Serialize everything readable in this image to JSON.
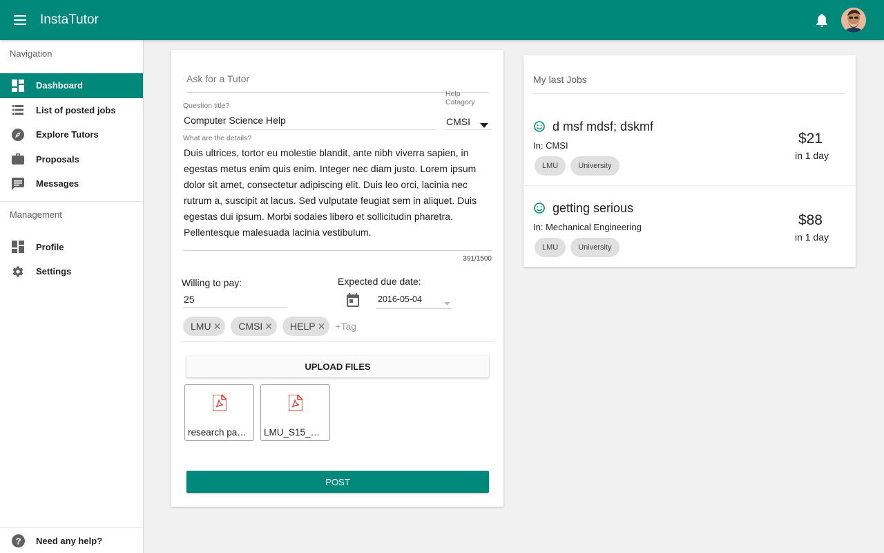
{
  "app": {
    "title": "InstaTutor",
    "accent": "#00897b"
  },
  "sidebar": {
    "navigation_title": "Navigation",
    "nav_items": [
      {
        "label": "Dashboard",
        "icon": "dashboard-icon",
        "active": true
      },
      {
        "label": "List of posted jobs",
        "icon": "list-icon"
      },
      {
        "label": "Explore Tutors",
        "icon": "compass-icon"
      },
      {
        "label": "Proposals",
        "icon": "briefcase-icon"
      },
      {
        "label": "Messages",
        "icon": "message-icon"
      }
    ],
    "management_title": "Management",
    "management_items": [
      {
        "label": "Profile",
        "icon": "dashboard-icon"
      },
      {
        "label": "Settings",
        "icon": "gear-icon"
      }
    ],
    "help_label": "Need any help?"
  },
  "ask": {
    "placeholder": "Ask for a Tutor",
    "question_label": "Question title?",
    "question_value": "Computer Science Help",
    "category_label": "Help Catagory",
    "category_value": "CMSI",
    "details_label": "What are the details?",
    "details_value": "Duis ultrices, tortor eu molestie blandit, ante nibh viverra sapien, in egestas metus enim quis enim. Integer nec diam justo. Lorem ipsum dolor sit amet, consectetur adipiscing elit. Duis leo orci, lacinia nec rutrum a, suscipit at lacus. Sed vulputate feugiat sem in aliquet. Duis egestas dui ipsum. Morbi sodales libero et sollicitudin pharetra. Pellentesque malesuada lacinia vestibulum.",
    "char_counter": "391/1500",
    "pay_label": "Willing to pay:",
    "pay_value": "25",
    "due_label": "Expected due date:",
    "due_value": "2016-05-04",
    "tags": [
      "LMU",
      "CMSI",
      "HELP"
    ],
    "tag_placeholder": "+Tag",
    "upload_label": "UPLOAD FILES",
    "files": [
      "research pa…",
      "LMU_S15_…"
    ],
    "post_label": "POST"
  },
  "jobs": {
    "title": "My last Jobs",
    "items": [
      {
        "title": "d msf mdsf; dskmf",
        "category": "In: CMSI",
        "tags": [
          "LMU",
          "University"
        ],
        "price": "$21",
        "due": "in 1 day"
      },
      {
        "title": "getting serious",
        "category": "In: Mechanical Engineering",
        "tags": [
          "LMU",
          "University"
        ],
        "price": "$88",
        "due": "in 1 day"
      }
    ]
  }
}
